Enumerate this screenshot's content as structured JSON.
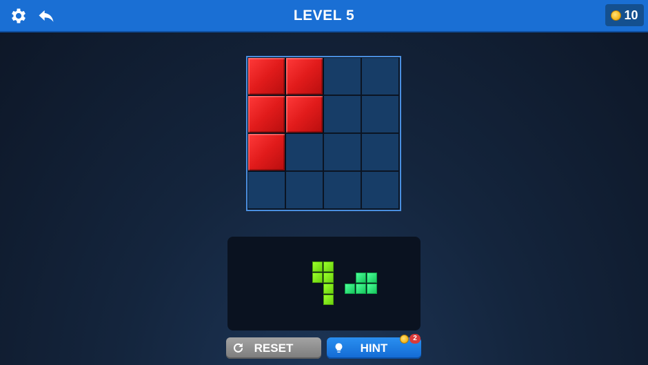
{
  "header": {
    "title": "LEVEL 5",
    "coins": "10",
    "settings_icon": "gear-icon",
    "back_icon": "undo-arrow-icon"
  },
  "board": {
    "rows": 4,
    "cols": 4,
    "filled_color": "#e11b1b",
    "empty_color": "#173d67",
    "filled_cells": [
      [
        0,
        0
      ],
      [
        0,
        1
      ],
      [
        1,
        0
      ],
      [
        1,
        1
      ],
      [
        2,
        0
      ]
    ]
  },
  "tray": {
    "pieces": [
      {
        "name": "lime-piece",
        "color": "lime",
        "cells": [
          [
            0,
            0
          ],
          [
            0,
            1
          ],
          [
            1,
            0
          ],
          [
            1,
            1
          ],
          [
            2,
            1
          ],
          [
            3,
            1
          ]
        ]
      },
      {
        "name": "green-piece",
        "color": "green",
        "cells": [
          [
            0,
            1
          ],
          [
            0,
            2
          ],
          [
            1,
            0
          ],
          [
            1,
            1
          ],
          [
            1,
            2
          ]
        ]
      }
    ]
  },
  "buttons": {
    "reset_label": "RESET",
    "hint_label": "HINT",
    "hint_cost": "2"
  },
  "colors": {
    "topbar": "#1a6fd4",
    "reset": "#8f8f8f",
    "hint": "#1f7fe6"
  }
}
